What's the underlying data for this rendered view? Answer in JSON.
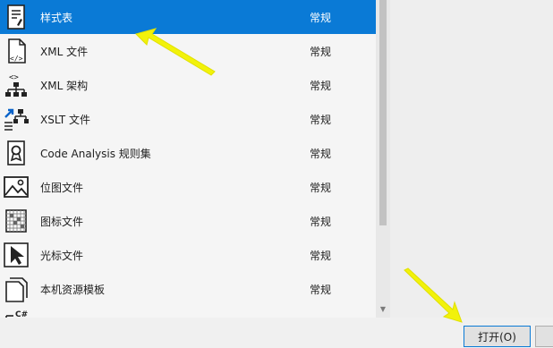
{
  "template_list": {
    "items": [
      {
        "name": "样式表",
        "category": "常规",
        "icon": "stylesheet-icon",
        "selected": true
      },
      {
        "name": "XML 文件",
        "category": "常规",
        "icon": "xml-file-icon"
      },
      {
        "name": "XML 架构",
        "category": "常规",
        "icon": "xml-schema-icon"
      },
      {
        "name": "XSLT 文件",
        "category": "常规",
        "icon": "xslt-file-icon"
      },
      {
        "name": "Code Analysis 规则集",
        "category": "常规",
        "icon": "ruleset-icon"
      },
      {
        "name": "位图文件",
        "category": "常规",
        "icon": "bitmap-icon"
      },
      {
        "name": "图标文件",
        "category": "常规",
        "icon": "icon-file-icon"
      },
      {
        "name": "光标文件",
        "category": "常规",
        "icon": "cursor-file-icon"
      },
      {
        "name": "本机资源模板",
        "category": "常规",
        "icon": "resource-template-icon"
      },
      {
        "name": "",
        "category": "",
        "icon": "csharp-file-icon"
      }
    ]
  },
  "buttons": {
    "open_label": "打开(O)"
  },
  "colors": {
    "selection": "#0a7ad6",
    "annotation_arrow": "#f2f20a"
  }
}
